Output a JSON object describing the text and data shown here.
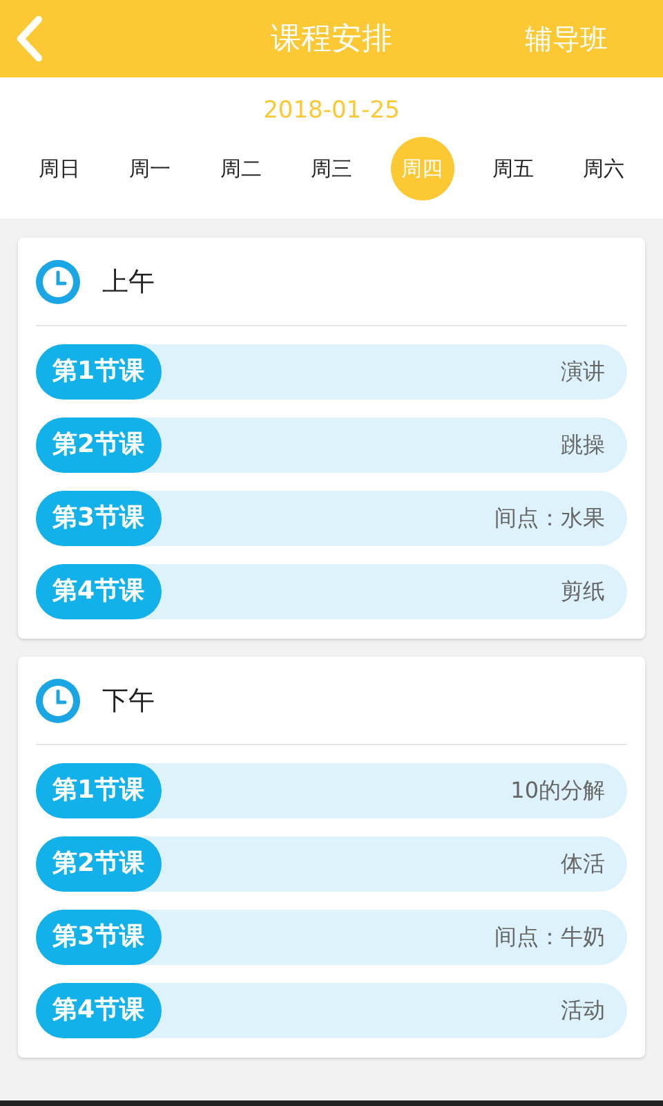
{
  "header": {
    "title": "课程安排",
    "action": "辅导班"
  },
  "date": "2018-01-25",
  "weekdays": [
    {
      "label": "周日",
      "selected": false
    },
    {
      "label": "周一",
      "selected": false
    },
    {
      "label": "周二",
      "selected": false
    },
    {
      "label": "周三",
      "selected": false
    },
    {
      "label": "周四",
      "selected": true
    },
    {
      "label": "周五",
      "selected": false
    },
    {
      "label": "周六",
      "selected": false
    }
  ],
  "sections": [
    {
      "title": "上午",
      "lessons": [
        {
          "label": "第1节课",
          "subject": "演讲"
        },
        {
          "label": "第2节课",
          "subject": "跳操"
        },
        {
          "label": "第3节课",
          "subject": "间点：水果"
        },
        {
          "label": "第4节课",
          "subject": "剪纸"
        }
      ]
    },
    {
      "title": "下午",
      "lessons": [
        {
          "label": "第1节课",
          "subject": "10的分解"
        },
        {
          "label": "第2节课",
          "subject": "体活"
        },
        {
          "label": "第3节课",
          "subject": "间点：牛奶"
        },
        {
          "label": "第4节课",
          "subject": "活动"
        }
      ]
    }
  ]
}
